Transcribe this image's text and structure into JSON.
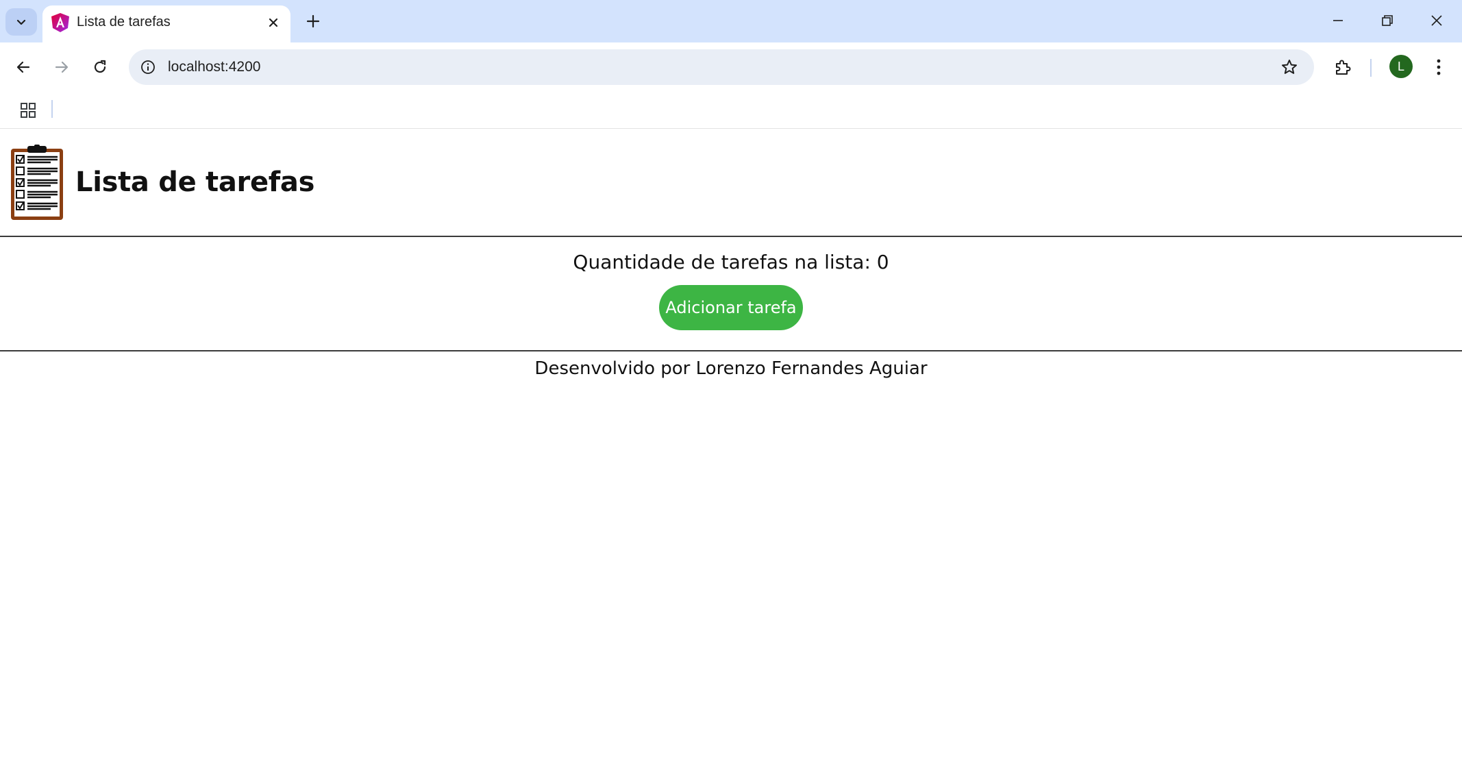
{
  "browser": {
    "tab": {
      "title": "Lista de tarefas",
      "favicon": "angular-icon"
    },
    "address_bar": {
      "url": "localhost:4200"
    },
    "profile": {
      "initial": "L",
      "color": "#23681f"
    },
    "accent_color": "#d3e3fd"
  },
  "page": {
    "title": "Lista de tarefas",
    "logo": "clipboard-checklist-icon",
    "task_count_text": "Quantidade de tarefas na lista: 0",
    "add_button_label": "Adicionar tarefa",
    "add_button_color": "#3db544",
    "footer_text": "Desenvolvido por Lorenzo Fernandes Aguiar"
  }
}
